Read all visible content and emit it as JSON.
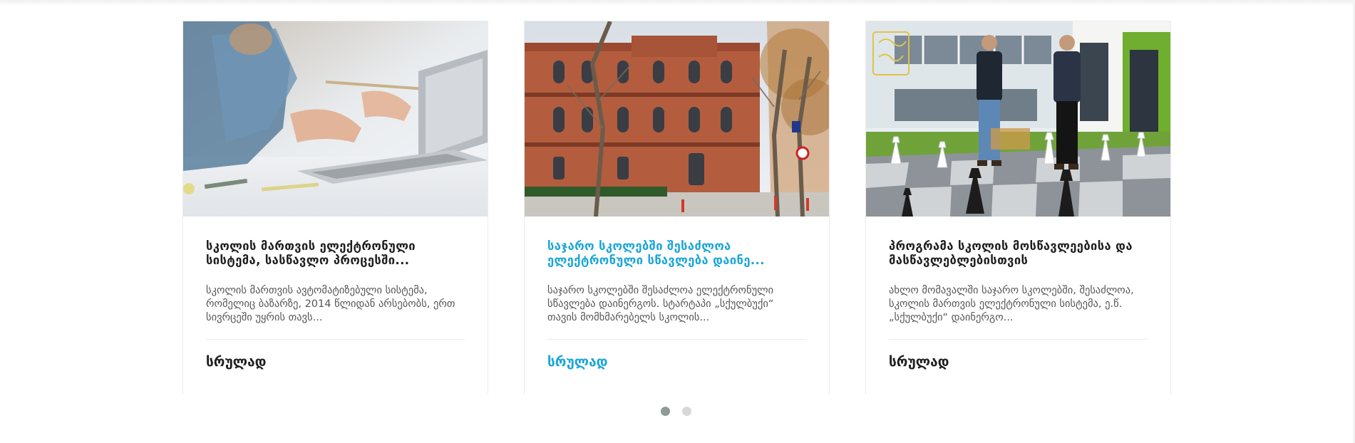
{
  "cards": [
    {
      "title": "სკოლის მართვის ელექტრონული სისტემა, სასწავლო პროცესში...",
      "excerpt": "სკოლის მართვის ავტომატიზებული სისტემა, რომელიც ბაზარზე, 2014 წლიდან არსებობს, ერთ სივრცეში უყრის თავს...",
      "more_label": "სრულად",
      "image": "laptop-work-photo"
    },
    {
      "title": "საჯარო სკოლებში შესაძლოა ელექტრონული სწავლება დაინე...",
      "excerpt": "საჯარო სკოლებში შესაძლოა ელექტრონული სწავლება დაინერგოს. სტარტაპი „სქულბუქი“ თავის მომხმარებელს სკოლის...",
      "more_label": "სრულად",
      "image": "school-building-photo"
    },
    {
      "title": "პროგრამა სკოლის მოსწავლეებისა და მასწავლებლებისთვის",
      "excerpt": "ახლო მომავალში საჯარო სკოლებში, შესაძლოა, სკოლის მართვის ელექტრონული სისტემა, ე.წ. „სქულბუქი“ დაინერგო...",
      "more_label": "სრულად",
      "image": "chess-founders-photo"
    }
  ],
  "carousel": {
    "active_index": 0,
    "page_count": 2
  },
  "colors": {
    "accent": "#1aa5d8",
    "title": "#1e1e1e",
    "text": "#555555",
    "dot_active": "#8e9b98",
    "dot_inactive": "#d8d8d8"
  }
}
